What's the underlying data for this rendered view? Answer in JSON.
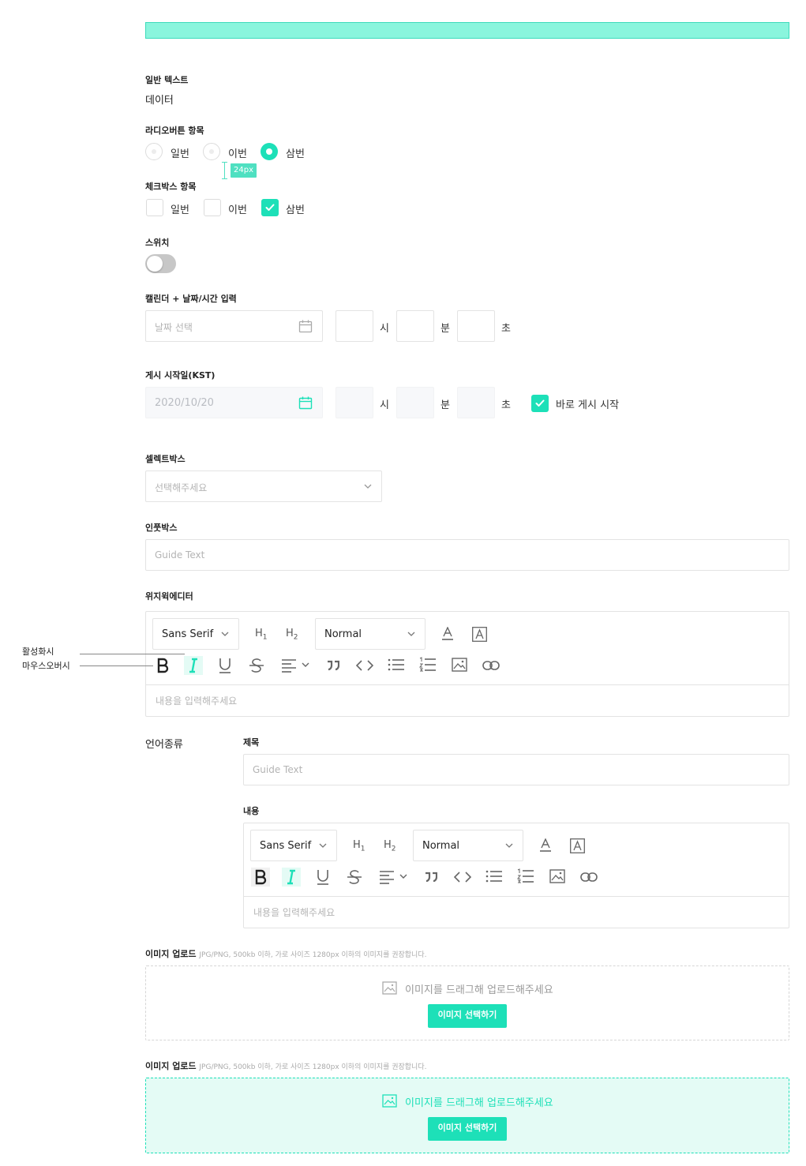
{
  "general_text": {
    "label": "일반 텍스트",
    "value": "데이터"
  },
  "radio_group": {
    "label": "라디오버튼 항목",
    "options": [
      "일번",
      "이번",
      "삼번"
    ],
    "selected": "삼번",
    "spacing_note": "24px"
  },
  "checkbox_group": {
    "label": "체크박스 항목",
    "options": [
      "일번",
      "이번",
      "삼번"
    ],
    "checked": [
      "삼번"
    ]
  },
  "switch": {
    "label": "스위치",
    "on": false
  },
  "calendar_input": {
    "label": "캘린더 + 날짜/시간 입력",
    "date_placeholder": "날짜 선택",
    "hour_unit": "시",
    "minute_unit": "분",
    "second_unit": "초"
  },
  "publish_start": {
    "label": "게시 시작일(KST)",
    "date_value": "2020/10/20",
    "hour_unit": "시",
    "minute_unit": "분",
    "second_unit": "초",
    "immediate_label": "바로 게시 시작",
    "immediate_checked": true
  },
  "select_box": {
    "label": "셀렉트박스",
    "placeholder": "선택해주세요"
  },
  "input_box": {
    "label": "인풋박스",
    "placeholder": "Guide Text"
  },
  "wysiwyg": {
    "label": "위지윅에디터",
    "font_select": "Sans Serif",
    "h1": "H",
    "h1_sub": "1",
    "h2": "H",
    "h2_sub": "2",
    "size_select": "Normal",
    "content_placeholder": "내용을 입력해주세요",
    "annotation_active": "활성화시",
    "annotation_hover": "마우스오버시"
  },
  "language": {
    "label": "언어종류",
    "title_label": "제목",
    "title_placeholder": "Guide Text",
    "content_label": "내용",
    "font_select": "Sans Serif",
    "h1": "H",
    "h1_sub": "1",
    "h2": "H",
    "h2_sub": "2",
    "size_select": "Normal",
    "content_placeholder": "내용을 입력해주세요"
  },
  "upload_default": {
    "label": "이미지 업로드",
    "note": "JPG/PNG, 500kb 이하, 가로 사이즈 1280px 이하의 이미지를 권장합니다.",
    "drop_text": "이미지를 드래그해 업로드해주세요",
    "button": "이미지 선택하기"
  },
  "upload_active": {
    "label": "이미지 업로드",
    "note": "JPG/PNG, 500kb 이하, 가로 사이즈 1280px 이하의 이미지를 권장합니다.",
    "drop_text": "이미지를 드래그해 업로드해주세요",
    "button": "이미지 선택하기"
  },
  "colors": {
    "accent": "#1de0b8",
    "topbar": "#8af5dd",
    "border": "#e3e3e3"
  }
}
